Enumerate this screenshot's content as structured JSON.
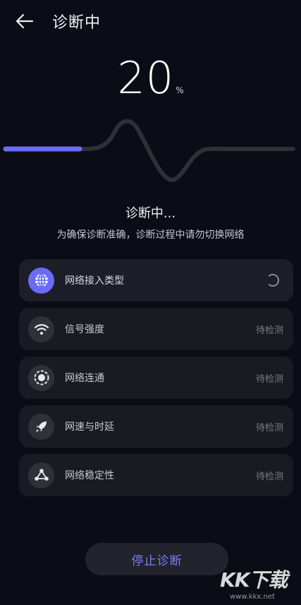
{
  "header": {
    "title": "诊断中"
  },
  "progress": {
    "value": "20",
    "unit": "%",
    "fraction": 0.2
  },
  "status": {
    "text": "诊断中...",
    "notice": "为确保诊断准确，诊断过程中请勿切换网络"
  },
  "items": [
    {
      "label": "网络接入类型",
      "status": "",
      "icon": "globe-icon",
      "state": "in-progress"
    },
    {
      "label": "信号强度",
      "status": "待检测",
      "icon": "wifi-icon",
      "state": "pending"
    },
    {
      "label": "网络连通",
      "status": "待检测",
      "icon": "target-icon",
      "state": "pending"
    },
    {
      "label": "网速与时延",
      "status": "待检测",
      "icon": "rocket-icon",
      "state": "pending"
    },
    {
      "label": "网络稳定性",
      "status": "待检测",
      "icon": "network-nodes-icon",
      "state": "pending"
    }
  ],
  "actions": {
    "stop_label": "停止诊断"
  },
  "watermark": {
    "logo": "KK下载",
    "url": "www.kkx.net"
  },
  "colors": {
    "accent": "#6a6cf7",
    "background": "#0b0c15",
    "card": "#191a22",
    "wave": "#2f3036"
  }
}
